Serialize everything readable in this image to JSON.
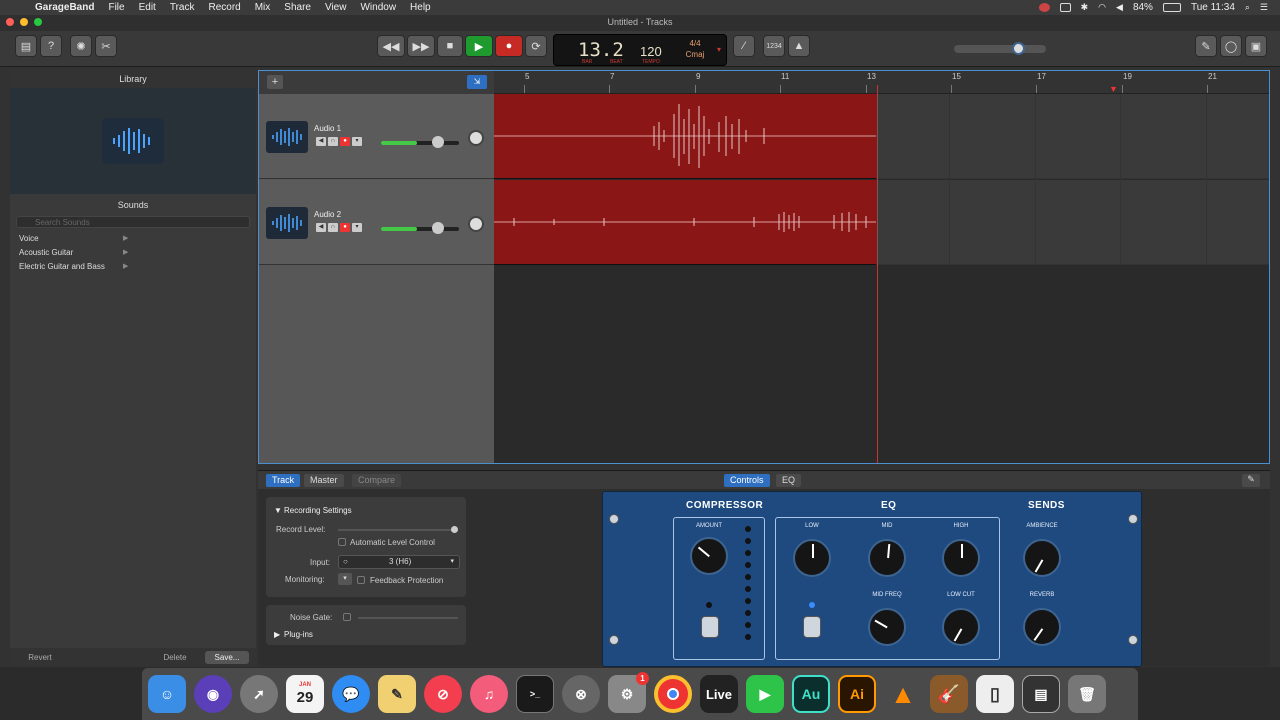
{
  "menubar": {
    "app": "GarageBand",
    "items": [
      "File",
      "Edit",
      "Track",
      "Record",
      "Mix",
      "Share",
      "View",
      "Window",
      "Help"
    ],
    "battery": "84%",
    "clock": "Tue 11:34"
  },
  "window": {
    "title": "Untitled - Tracks"
  },
  "lcd": {
    "position": "13.2",
    "bar_label": "BAR",
    "beat_label": "BEAT",
    "tempo": "120",
    "tempo_label": "TEMPO",
    "time_sig": "4/4",
    "key": "Cmaj"
  },
  "toolbar": {
    "count_in": "1234"
  },
  "library": {
    "title": "Library",
    "sounds_title": "Sounds",
    "search_placeholder": "Search Sounds",
    "items": [
      "Voice",
      "Acoustic Guitar",
      "Electric Guitar and Bass"
    ],
    "revert": "Revert",
    "delete": "Delete",
    "save": "Save..."
  },
  "ruler": {
    "ticks": [
      "5",
      "7",
      "9",
      "11",
      "13",
      "15",
      "17",
      "19",
      "21"
    ]
  },
  "tracks": [
    {
      "name": "Audio 1"
    },
    {
      "name": "Audio 2"
    }
  ],
  "editor": {
    "tabs": {
      "track": "Track",
      "master": "Master",
      "compare": "Compare",
      "controls": "Controls",
      "eq": "EQ"
    },
    "recording_settings": "Recording Settings",
    "record_level": "Record Level:",
    "auto_level": "Automatic Level Control",
    "input_label": "Input:",
    "input_value": "3  (H6)",
    "monitoring": "Monitoring:",
    "feedback": "Feedback Protection",
    "noise_gate": "Noise Gate:",
    "plugins": "Plug-ins"
  },
  "amp": {
    "compressor": "COMPRESSOR",
    "eq": "EQ",
    "sends": "SENDS",
    "amount": "AMOUNT",
    "low": "LOW",
    "mid": "MID",
    "high": "HIGH",
    "ambience": "AMBIENCE",
    "mid_freq": "MID FREQ",
    "low_cut": "LOW CUT",
    "reverb": "REVERB"
  },
  "dock": {
    "calendar_month": "JAN",
    "calendar_day": "29",
    "badge": "1",
    "live": "Live",
    "au": "Au",
    "ai": "Ai",
    "terminal": ">_"
  }
}
